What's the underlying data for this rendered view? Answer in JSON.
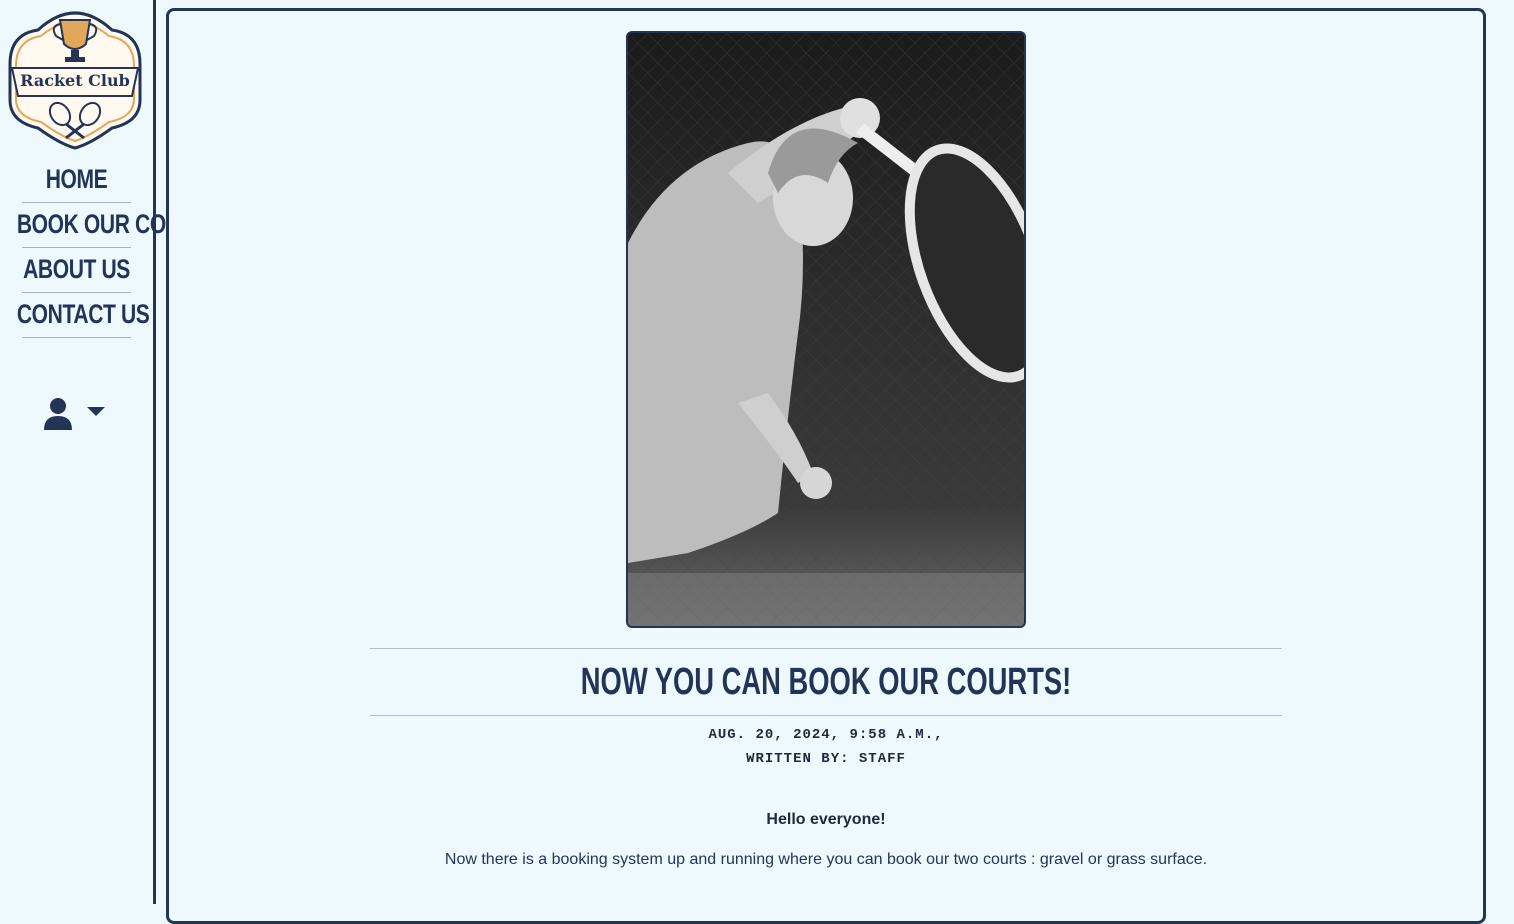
{
  "sidebar": {
    "logo": {
      "text": "Racket Club",
      "icon": "racket-club-logo"
    },
    "nav": [
      {
        "label": "HOME"
      },
      {
        "label": "BOOK OUR COURT"
      },
      {
        "label": "ABOUT US"
      },
      {
        "label": "CONTACT US"
      }
    ],
    "user_menu": {
      "icon": "user-icon",
      "caret": "caret-down-icon"
    }
  },
  "post": {
    "image": {
      "description_icon": "tennis-player-photo"
    },
    "title": "NOW YOU CAN BOOK OUR COURTS!",
    "date": "AUG. 20, 2024, 9:58 A.M.,",
    "author": "WRITTEN BY: STAFF",
    "greeting": "Hello everyone!",
    "body": "Now there is a booking system up and running where you can book our two courts : gravel or grass surface."
  },
  "colors": {
    "background": "#eef9fe",
    "navy": "#243457",
    "gold": "#e2a85a"
  }
}
